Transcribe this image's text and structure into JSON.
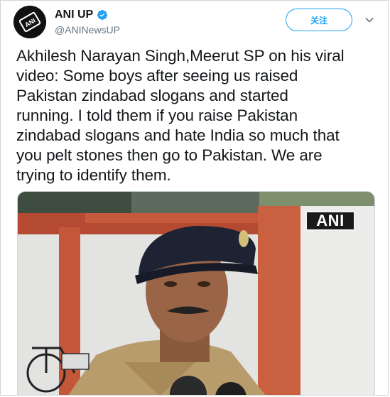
{
  "account": {
    "display_name": "ANI UP",
    "handle": "@ANINewsUP",
    "avatar_icon": "ani-logo-icon",
    "verified_icon": "verified-badge-icon"
  },
  "actions": {
    "follow_label": "关注",
    "more_icon": "chevron-down-icon"
  },
  "tweet": {
    "lines": [
      "Akhilesh Narayan Singh,Meerut SP on his viral",
      "video: Some boys after seeing us raised",
      "Pakistan zindabad slogans and started",
      "running. I told them if you raise Pakistan",
      "zindabad slogans and hate India so much that",
      "you pelt stones then go to Pakistan. We are",
      "trying to identify them."
    ]
  },
  "media": {
    "watermark": "ANI"
  },
  "colors": {
    "accent": "#1da1f2",
    "text": "#14171a",
    "muted": "#657786"
  }
}
